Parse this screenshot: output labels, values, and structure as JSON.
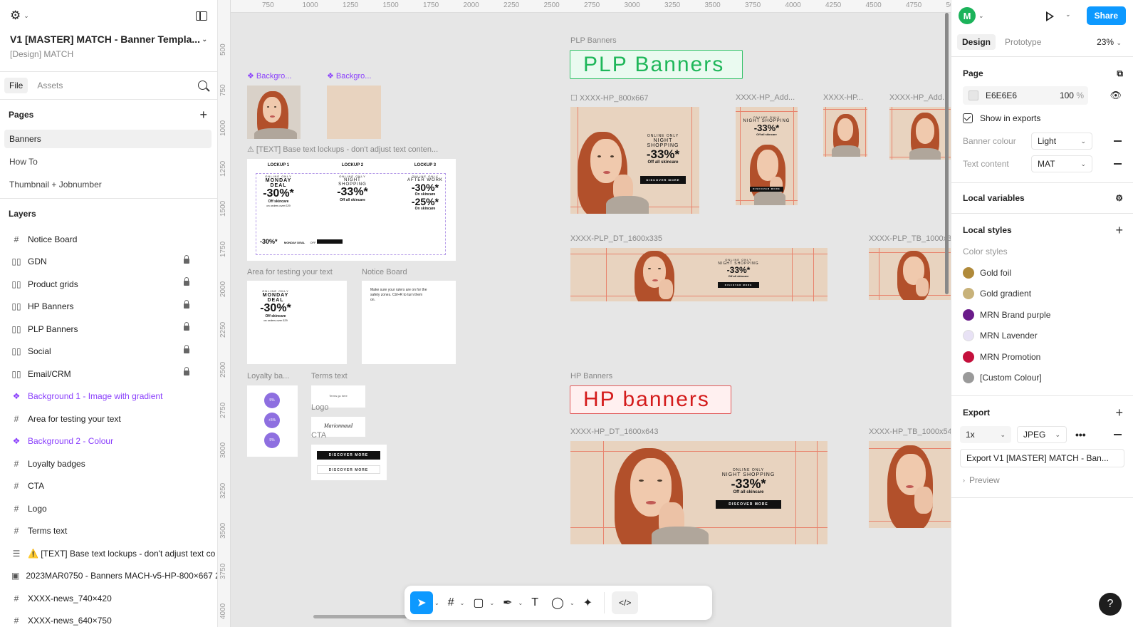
{
  "file": {
    "title": "V1 [MASTER] MATCH - Banner Templa...",
    "subtitle": "[Design] MATCH"
  },
  "left_tabs": [
    "File",
    "Assets"
  ],
  "pages": {
    "heading": "Pages",
    "items": [
      "Banners",
      "How To",
      "Thumbnail + Jobnumber"
    ]
  },
  "layers": {
    "heading": "Layers",
    "items": [
      {
        "label": "Notice Board",
        "icon": "#",
        "locked": false,
        "purple": false
      },
      {
        "label": "GDN",
        "icon": "▯▯",
        "locked": true,
        "purple": false
      },
      {
        "label": "Product grids",
        "icon": "▯▯",
        "locked": true,
        "purple": false
      },
      {
        "label": "HP Banners",
        "icon": "▯▯",
        "locked": true,
        "purple": false
      },
      {
        "label": "PLP Banners",
        "icon": "▯▯",
        "locked": true,
        "purple": false
      },
      {
        "label": "Social",
        "icon": "▯▯",
        "locked": true,
        "purple": false
      },
      {
        "label": "Email/CRM",
        "icon": "▯▯",
        "locked": true,
        "purple": false
      },
      {
        "label": "Background 1 - Image with gradient",
        "icon": "❖",
        "locked": false,
        "purple": true
      },
      {
        "label": "Area for testing your text",
        "icon": "#",
        "locked": false,
        "purple": false
      },
      {
        "label": "Background 2 - Colour",
        "icon": "❖",
        "locked": false,
        "purple": true
      },
      {
        "label": "Loyalty badges",
        "icon": "#",
        "locked": false,
        "purple": false
      },
      {
        "label": "CTA",
        "icon": "#",
        "locked": false,
        "purple": false
      },
      {
        "label": "Logo",
        "icon": "#",
        "locked": false,
        "purple": false
      },
      {
        "label": "Terms text",
        "icon": "#",
        "locked": false,
        "purple": false
      },
      {
        "label": "⚠️ [TEXT] Base text lockups - don't adjust text co",
        "icon": "☰",
        "locked": false,
        "purple": false
      },
      {
        "label": "2023MAR0750 - Banners MACH-v5-HP-800×667 2",
        "icon": "▣",
        "locked": false,
        "purple": false
      },
      {
        "label": "XXXX-news_740×420",
        "icon": "#",
        "locked": false,
        "purple": false
      },
      {
        "label": "XXXX-news_640×750",
        "icon": "#",
        "locked": false,
        "purple": false
      }
    ]
  },
  "ruler": {
    "top": [
      "750",
      "1000",
      "1250",
      "1500",
      "1750",
      "2000",
      "2250",
      "2500",
      "2750",
      "3000",
      "3250",
      "3500",
      "3750",
      "4000",
      "4250",
      "4500",
      "4750",
      "50"
    ],
    "left": [
      "500",
      "750",
      "1000",
      "1250",
      "1500",
      "1750",
      "2000",
      "2250",
      "2500",
      "2750",
      "3000",
      "3250",
      "3500",
      "3750",
      "4000"
    ]
  },
  "canvas": {
    "labels": {
      "bg1": "❖ Backgro...",
      "bg2": "❖ Backgro...",
      "lockups": "⚠ [TEXT] Base text lockups - don't adjust text conten...",
      "testing": "Area for testing your text",
      "notice": "Notice Board",
      "loyalty": "Loyalty ba...",
      "terms": "Terms text",
      "logo": "Logo",
      "cta": "CTA",
      "plp_section": "PLP Banners",
      "hp_800": "☐ XXXX-HP_800x667",
      "hp_add1": "XXXX-HP_Add...",
      "hp_small": "XXXX-HP...",
      "hp_add2": "XXXX-HP_Add...",
      "plp_dt": "XXXX-PLP_DT_1600x335",
      "plp_tb": "XXXX-PLP_TB_1000x3",
      "hp_section": "HP Banners",
      "hp_dt": "XXXX-HP_DT_1600x643",
      "hp_tb": "XXXX-HP_TB_1000x54"
    },
    "plp_title": "PLP Banners",
    "hp_title": "HP banners",
    "lockups": {
      "l1": "LOCKUP 1",
      "l2": "LOCKUP 2",
      "l3": "LOCKUP 3",
      "online_only": "ONLINE ONLY",
      "monday": "MONDAY",
      "deal": "DEAL",
      "night": "NIGHT",
      "shopping": "SHOPPING",
      "after_work": "AFTER WORK",
      "pct30": "-30%*",
      "pct33": "-33%*",
      "pct25": "-25%*",
      "off_skincare": "Off skincare",
      "off_all_skincare": "Off all skincare",
      "on_skincare": "On skincare",
      "orders_over": "on orders over £29",
      "monday_deal": "MONDAY DEAL",
      "off_orders": "OFF 10 ORDERS"
    },
    "notice_text": "Make sure your rulers are on for the safety zones. Ctrl+R to turn them on.",
    "terms_text": "Terms go here",
    "logo_text": "Marionnaud",
    "cta_text": "DISCOVER MORE",
    "badge_text": [
      "5%",
      "+5%",
      "5%"
    ],
    "banner": {
      "online_only": "ONLINE ONLY",
      "night_shopping": "NIGHT SHOPPING",
      "pct": "-33%*",
      "off": "Off all skincare",
      "cta": "DISCOVER MORE"
    }
  },
  "toolbar": {
    "items": [
      "move",
      "frame",
      "shape",
      "pen",
      "text",
      "comment",
      "actions",
      "dev-mode"
    ]
  },
  "right": {
    "avatar": "M",
    "share": "Share",
    "tabs": [
      "Design",
      "Prototype"
    ],
    "zoom": "23%",
    "page_heading": "Page",
    "page_color": "E6E6E6",
    "page_opacity": "100",
    "page_opacity_unit": "%",
    "show_exports": "Show in exports",
    "variables": [
      {
        "label": "Banner colour",
        "value": "Light"
      },
      {
        "label": "Text content",
        "value": "MAT"
      }
    ],
    "local_variables": "Local variables",
    "local_styles": "Local styles",
    "color_styles_heading": "Color styles",
    "color_styles": [
      {
        "name": "Gold foil",
        "color": "#b08a3a"
      },
      {
        "name": "Gold gradient",
        "color": "#c8b27a"
      },
      {
        "name": "MRN Brand purple",
        "color": "#6a1b8a"
      },
      {
        "name": "MRN Lavender",
        "color": "#e8e2f5"
      },
      {
        "name": "MRN Promotion",
        "color": "#c4103c"
      },
      {
        "name": "[Custom Colour]",
        "color": "#9a9a9a"
      }
    ],
    "export_heading": "Export",
    "export_scale": "1x",
    "export_format": "JPEG",
    "export_button": "Export V1 [MASTER] MATCH - Ban...",
    "preview": "Preview",
    "help": "?"
  }
}
